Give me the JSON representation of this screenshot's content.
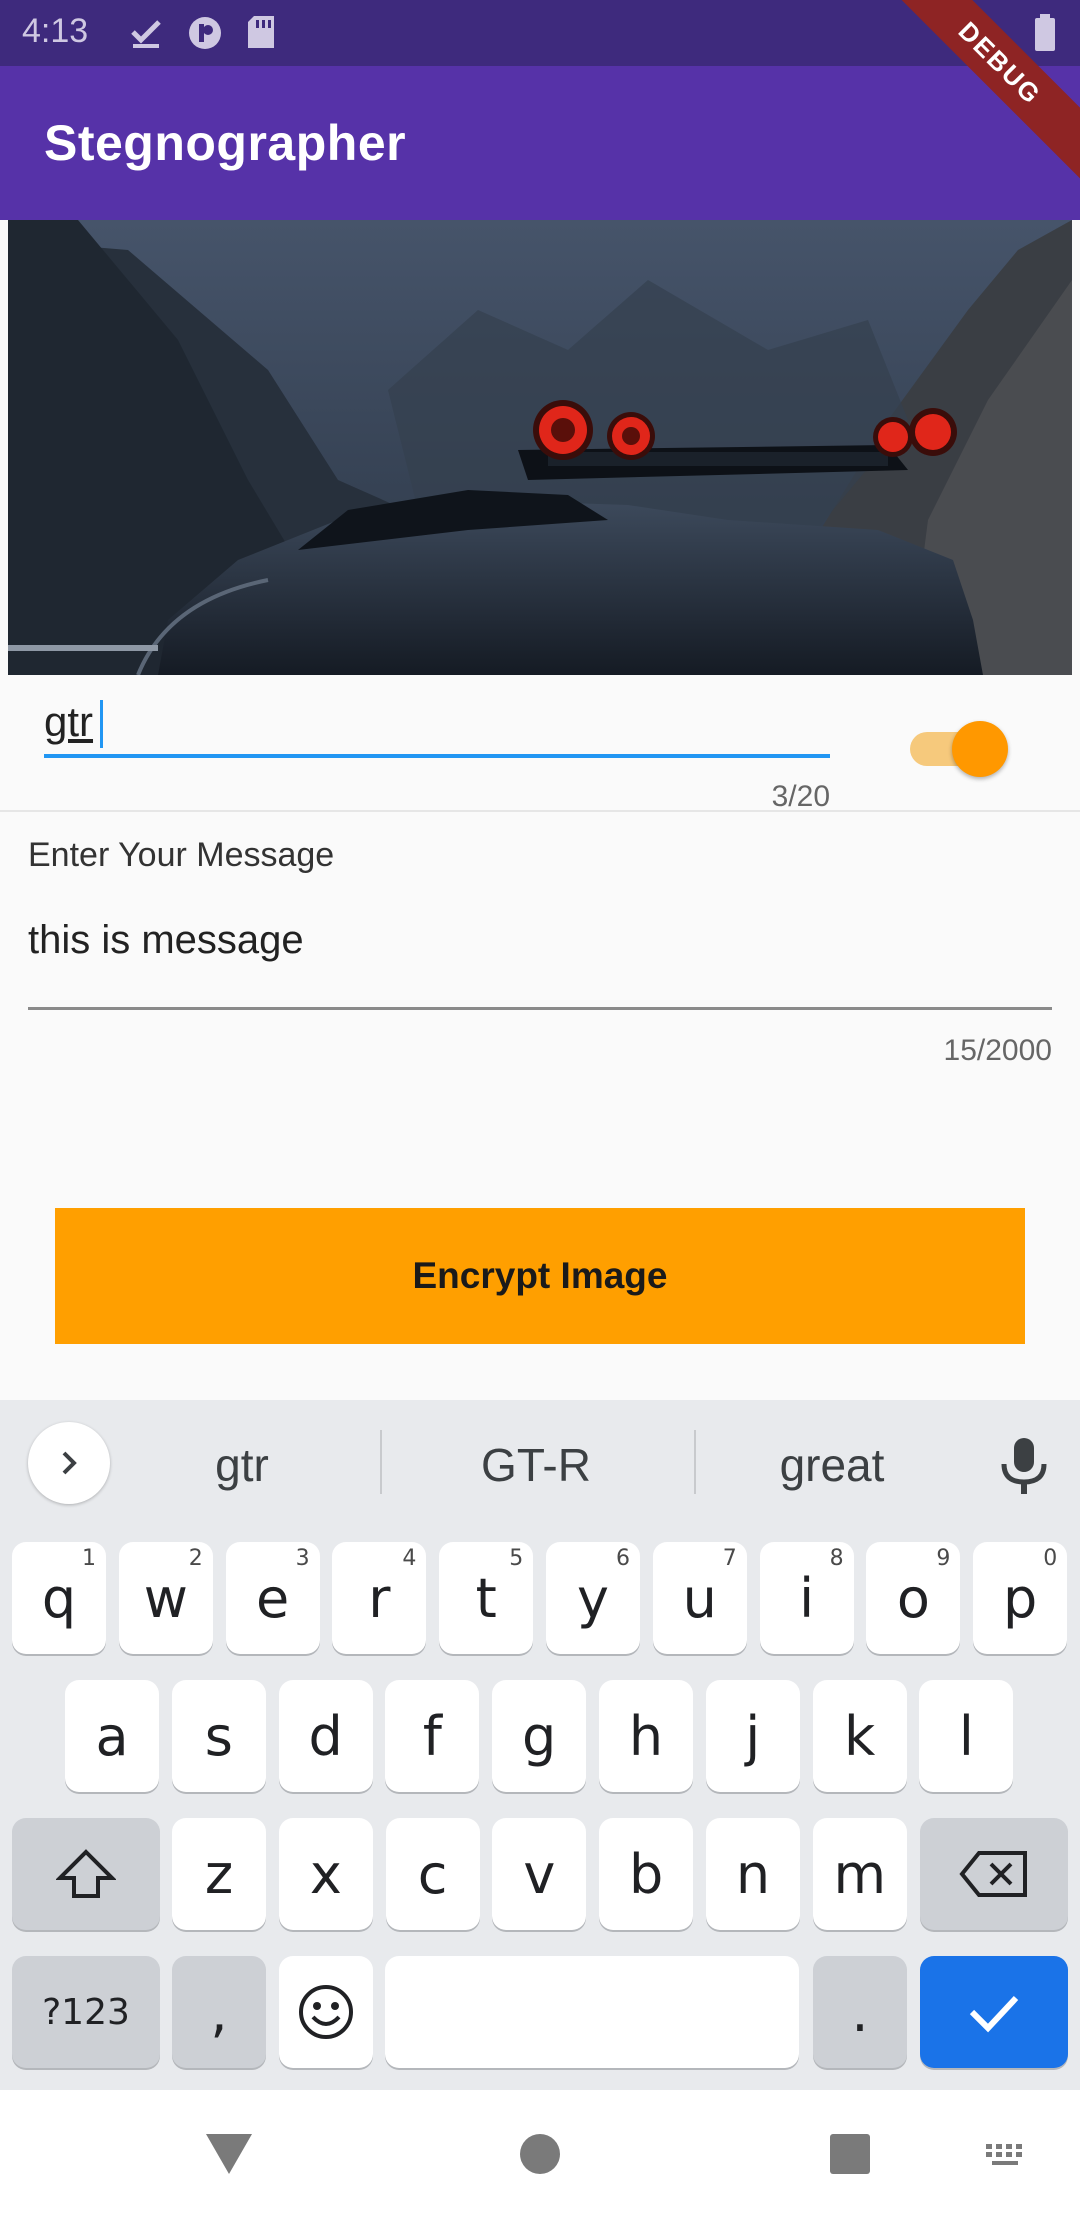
{
  "status_bar": {
    "time": "4:13"
  },
  "debug_banner": "DEBUG",
  "app_bar": {
    "title": "Stegnographer"
  },
  "password_field": {
    "value": "gtr",
    "counter": "3/20"
  },
  "toggle": {
    "on": true
  },
  "message_field": {
    "label": "Enter Your Message",
    "value": "this is message",
    "counter": "15/2000"
  },
  "encrypt_button": {
    "label": "Encrypt Image"
  },
  "keyboard": {
    "suggestions": [
      "gtr",
      "GT-R",
      "great"
    ],
    "row1": [
      {
        "k": "q",
        "h": "1"
      },
      {
        "k": "w",
        "h": "2"
      },
      {
        "k": "e",
        "h": "3"
      },
      {
        "k": "r",
        "h": "4"
      },
      {
        "k": "t",
        "h": "5"
      },
      {
        "k": "y",
        "h": "6"
      },
      {
        "k": "u",
        "h": "7"
      },
      {
        "k": "i",
        "h": "8"
      },
      {
        "k": "o",
        "h": "9"
      },
      {
        "k": "p",
        "h": "0"
      }
    ],
    "row2": [
      "a",
      "s",
      "d",
      "f",
      "g",
      "h",
      "j",
      "k",
      "l"
    ],
    "row3": [
      "z",
      "x",
      "c",
      "v",
      "b",
      "n",
      "m"
    ],
    "symbols_key": "?123",
    "comma_key": ",",
    "period_key": "."
  },
  "colors": {
    "app_bar": "#5632a8",
    "status_bar": "#3e2a7d",
    "accent": "#ff9800",
    "focus": "#2196f3",
    "enter_key": "#1a73e8"
  }
}
